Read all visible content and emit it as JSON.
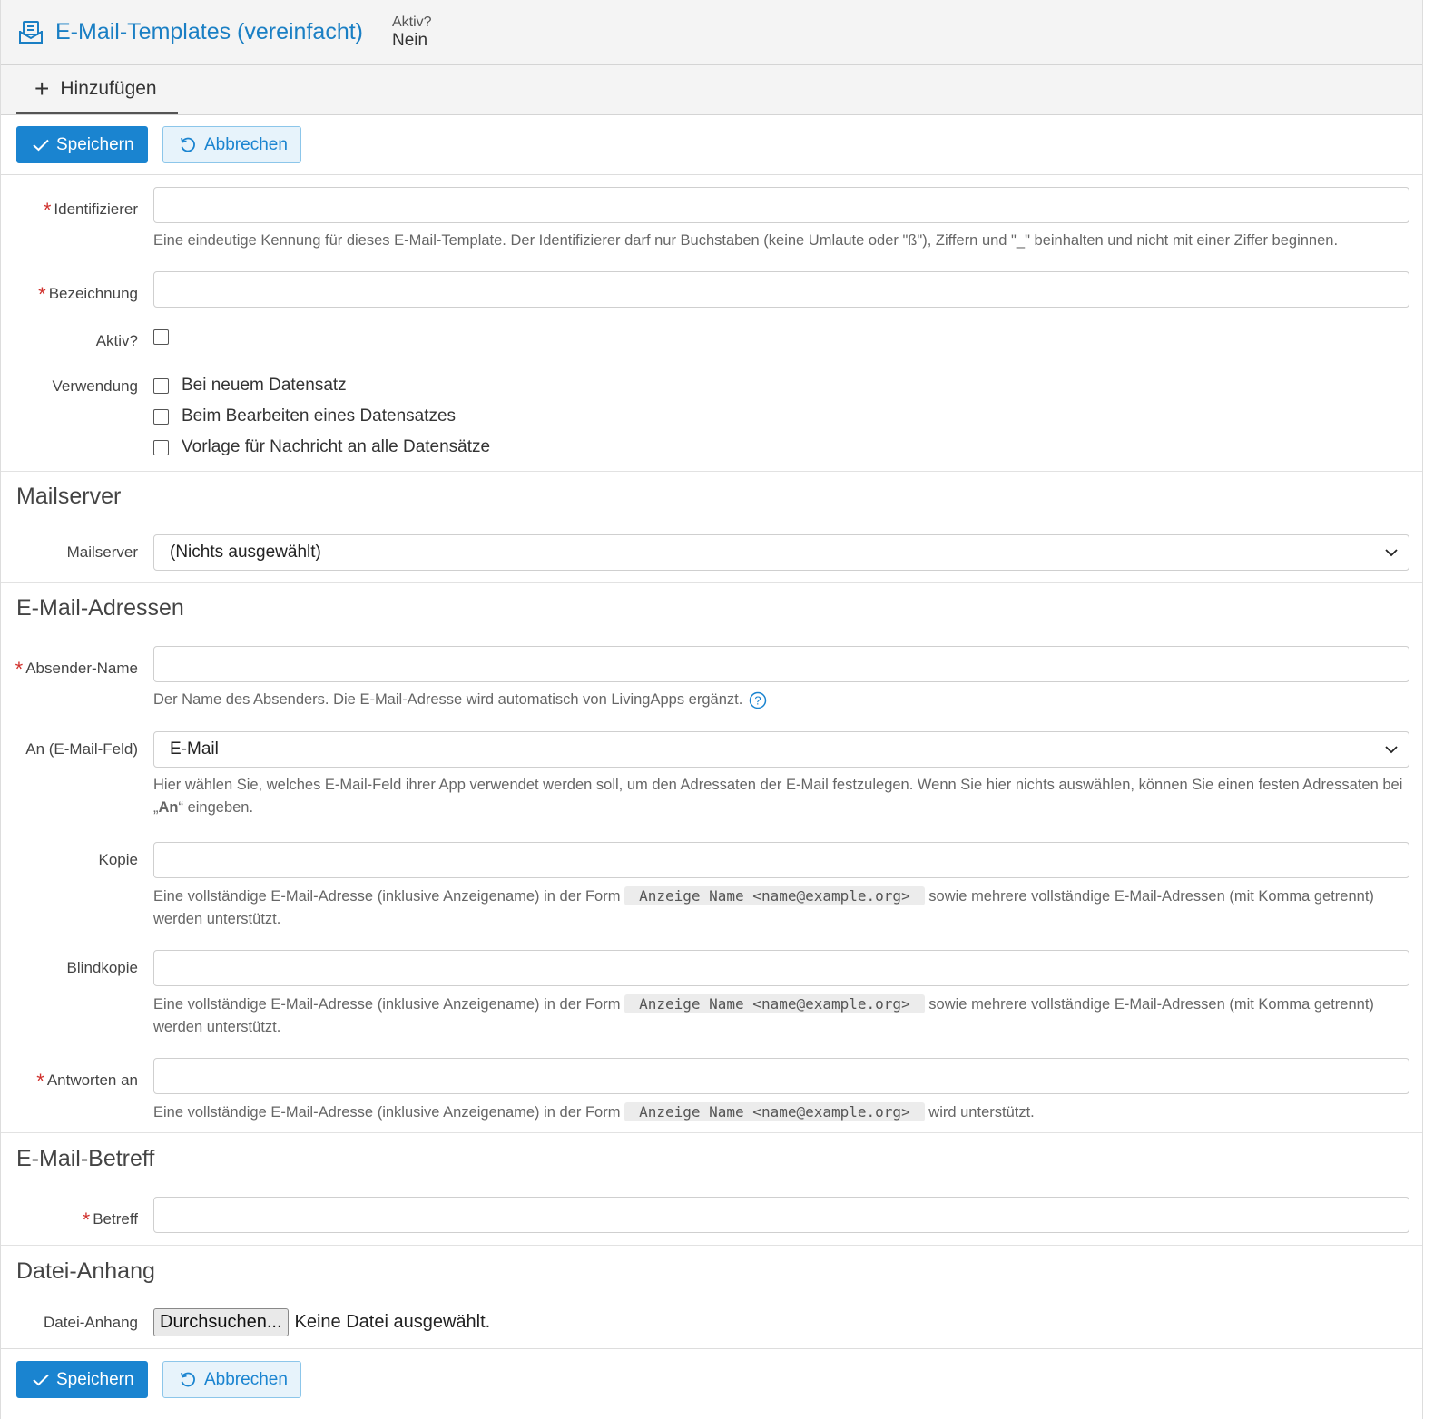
{
  "header": {
    "title": "E-Mail-Templates (vereinfacht)",
    "status_label": "Aktiv?",
    "status_value": "Nein"
  },
  "tabs": [
    {
      "label": "Hinzufügen",
      "icon": "plus-icon"
    }
  ],
  "toolbar": {
    "save_label": "Speichern",
    "cancel_label": "Abbrechen"
  },
  "form": {
    "identifier": {
      "label": "Identifizierer",
      "value": "",
      "help": "Eine eindeutige Kennung für dieses E-Mail-Template. Der Identifizierer darf nur Buchstaben (keine Umlaute oder \"ß\"), Ziffern und \"_\" beinhalten und nicht mit einer Ziffer beginnen."
    },
    "name": {
      "label": "Bezeichnung",
      "value": ""
    },
    "active": {
      "label": "Aktiv?",
      "checked": false
    },
    "usage": {
      "label": "Verwendung",
      "options": [
        {
          "label": "Bei neuem Datensatz",
          "checked": false
        },
        {
          "label": "Beim Bearbeiten eines Datensatzes",
          "checked": false
        },
        {
          "label": "Vorlage für Nachricht an alle Datensätze",
          "checked": false
        }
      ]
    }
  },
  "mailserver_section": {
    "title": "Mailserver",
    "field_label": "Mailserver",
    "selected": "(Nichts ausgewählt)"
  },
  "addresses_section": {
    "title": "E-Mail-Adressen",
    "sender": {
      "label": "Absender-Name",
      "value": "",
      "help": "Der Name des Absenders. Die E-Mail-Adresse wird automatisch von LivingApps ergänzt."
    },
    "to": {
      "label": "An (E-Mail-Feld)",
      "selected": "E-Mail",
      "help_line1": "Hier wählen Sie, welches E-Mail-Feld ihrer App verwendet werden soll, um den Adressaten der E-Mail festzulegen. Wenn Sie hier nichts auswählen, können Sie einen festen Adressaten bei",
      "help_quote_open": "„",
      "help_bold": "An",
      "help_quote_close": "“ eingeben."
    },
    "cc": {
      "label": "Kopie",
      "value": "",
      "help_pre": "Eine vollständige E-Mail-Adresse (inklusive Anzeigename) in der Form",
      "help_code": "Anzeige Name <name@example.org>",
      "help_post": "sowie mehrere vollständige E-Mail-Adressen (mit Komma getrennt)",
      "help_line2": "werden unterstützt."
    },
    "bcc": {
      "label": "Blindkopie",
      "value": "",
      "help_pre": "Eine vollständige E-Mail-Adresse (inklusive Anzeigename) in der Form",
      "help_code": "Anzeige Name <name@example.org>",
      "help_post": "sowie mehrere vollständige E-Mail-Adressen (mit Komma getrennt)",
      "help_line2": "werden unterstützt."
    },
    "reply_to": {
      "label": "Antworten an",
      "value": "",
      "help_pre": "Eine vollständige E-Mail-Adresse (inklusive Anzeigename) in der Form",
      "help_code": "Anzeige Name <name@example.org>",
      "help_post": "wird unterstützt."
    }
  },
  "subject_section": {
    "title": "E-Mail-Betreff",
    "label": "Betreff",
    "value": ""
  },
  "attachment_section": {
    "title": "Datei-Anhang",
    "label": "Datei-Anhang",
    "button": "Durchsuchen...",
    "status": "Keine Datei ausgewählt."
  },
  "colors": {
    "accent": "#1a84d0",
    "title": "#1a7fc4",
    "required": "#d0312d",
    "header_bg": "#f4f4f4"
  }
}
